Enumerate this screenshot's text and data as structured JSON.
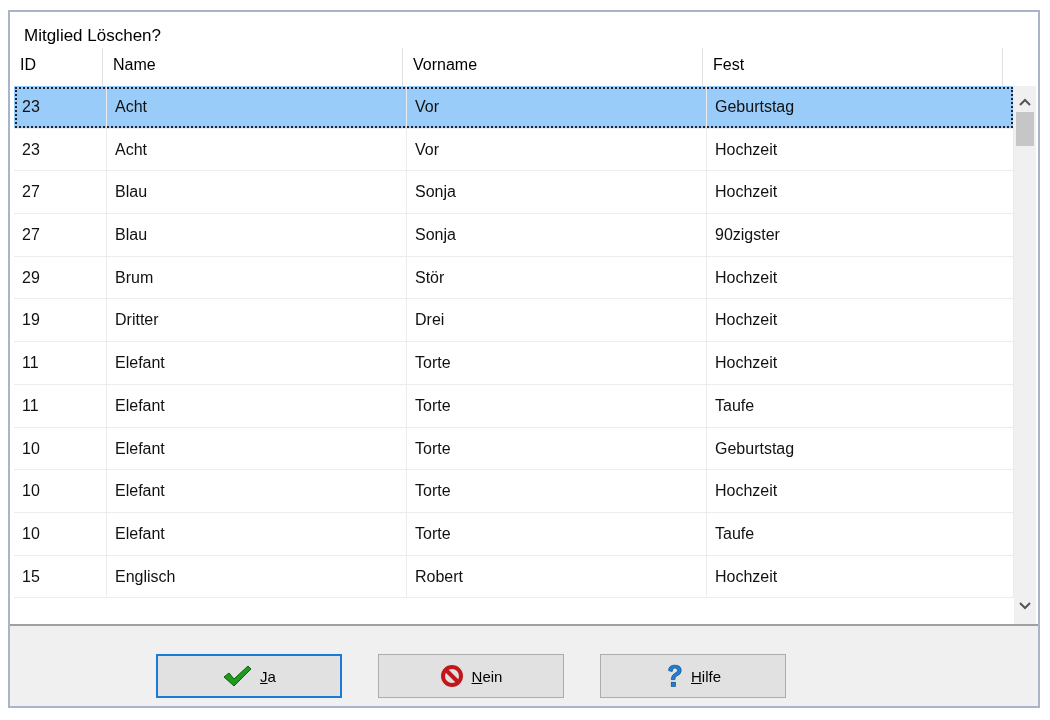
{
  "window": {
    "title": "Mitglied Löschen?"
  },
  "table": {
    "columns": [
      "ID",
      "Name",
      "Vorname",
      "Fest"
    ],
    "rows": [
      {
        "cells": [
          "23",
          "Acht",
          "Vor",
          "Geburtstag"
        ],
        "selected": true
      },
      {
        "cells": [
          "23",
          "Acht",
          "Vor",
          "Hochzeit"
        ],
        "selected": false
      },
      {
        "cells": [
          "27",
          "Blau",
          "Sonja",
          "Hochzeit"
        ],
        "selected": false
      },
      {
        "cells": [
          "27",
          "Blau",
          "Sonja",
          "90zigster"
        ],
        "selected": false
      },
      {
        "cells": [
          "29",
          "Brum",
          "Stör",
          "Hochzeit"
        ],
        "selected": false
      },
      {
        "cells": [
          "19",
          "Dritter",
          "Drei",
          "Hochzeit"
        ],
        "selected": false
      },
      {
        "cells": [
          "11",
          "Elefant",
          "Torte",
          "Hochzeit"
        ],
        "selected": false
      },
      {
        "cells": [
          "11",
          "Elefant",
          "Torte",
          "Taufe"
        ],
        "selected": false
      },
      {
        "cells": [
          "10",
          "Elefant",
          "Torte",
          "Geburtstag"
        ],
        "selected": false
      },
      {
        "cells": [
          "10",
          "Elefant",
          "Torte",
          "Hochzeit"
        ],
        "selected": false
      },
      {
        "cells": [
          "10",
          "Elefant",
          "Torte",
          "Taufe"
        ],
        "selected": false
      },
      {
        "cells": [
          "15",
          "Englisch",
          "Robert",
          "Hochzeit"
        ],
        "selected": false
      }
    ]
  },
  "buttons": [
    {
      "kind": "yes",
      "label": "Ja",
      "focused": true
    },
    {
      "kind": "no",
      "label": "Nein",
      "focused": false
    },
    {
      "kind": "help",
      "label": "Hilfe",
      "focused": false
    }
  ]
}
